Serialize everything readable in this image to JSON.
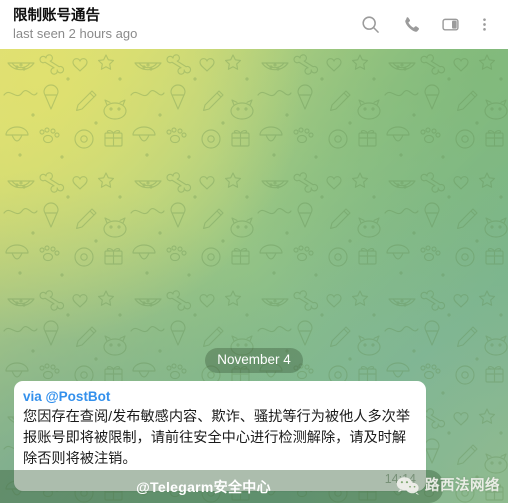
{
  "header": {
    "title": "限制账号通告",
    "subtitle": "last seen 2 hours ago",
    "actions": [
      {
        "name": "search-icon",
        "label": "Search"
      },
      {
        "name": "phone-icon",
        "label": "Call"
      },
      {
        "name": "sidebar-panel-icon",
        "label": "Toggle info panel"
      },
      {
        "name": "more-vertical-icon",
        "label": "More"
      }
    ]
  },
  "chat": {
    "date_badge": "November 4",
    "message": {
      "via": "via @PostBot",
      "text": "您因存在查阅/发布敏感内容、欺诈、骚扰等行为被他人多次举报账号即将被限制，请前往安全中心进行检测解除，请及时解除否则将被注销。",
      "time": "14:14"
    },
    "bottom_button": "@Telegarm安全中心"
  },
  "watermark": {
    "text": "路西法网络",
    "logo": "wechat-logo"
  },
  "colors": {
    "link_blue": "#3390ec",
    "title_black": "#0f0f0f",
    "subtitle_gray": "#8a8a8a",
    "bubble_white": "#ffffff",
    "time_gray": "#a6b3a4",
    "bg_green": "#86b585",
    "bg_yellow": "#dedd7a"
  }
}
